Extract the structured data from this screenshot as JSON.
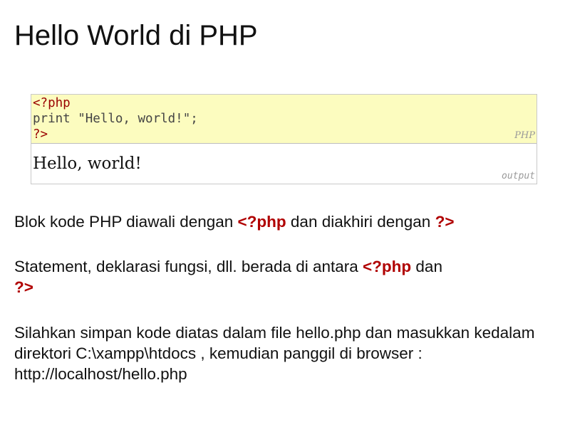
{
  "slide": {
    "title": "Hello World di PHP"
  },
  "code_box": {
    "lines": [
      "<?php",
      "print \"Hello, world!\";",
      "?>"
    ],
    "language_tag": "PHP",
    "output_text": "Hello, world!",
    "output_tag": "output",
    "code_background": "#fcfcbf"
  },
  "paragraphs": {
    "p1": {
      "before": "Blok kode PHP diawali dengan ",
      "open_tag": "<?php",
      "middle": " dan diakhiri dengan ",
      "close_tag": "?>"
    },
    "p2": {
      "before": "Statement, deklarasi fungsi, dll. berada di antara ",
      "open_tag": "<?php",
      "middle": " dan ",
      "close_tag": "?>"
    },
    "p3": {
      "text": "Silahkan simpan kode diatas dalam file hello.php dan masukkan kedalam direktori C:\\xampp\\htdocs , kemudian panggil di browser : http://localhost/hello.php"
    }
  },
  "colors": {
    "highlight_red": "#b00000"
  }
}
